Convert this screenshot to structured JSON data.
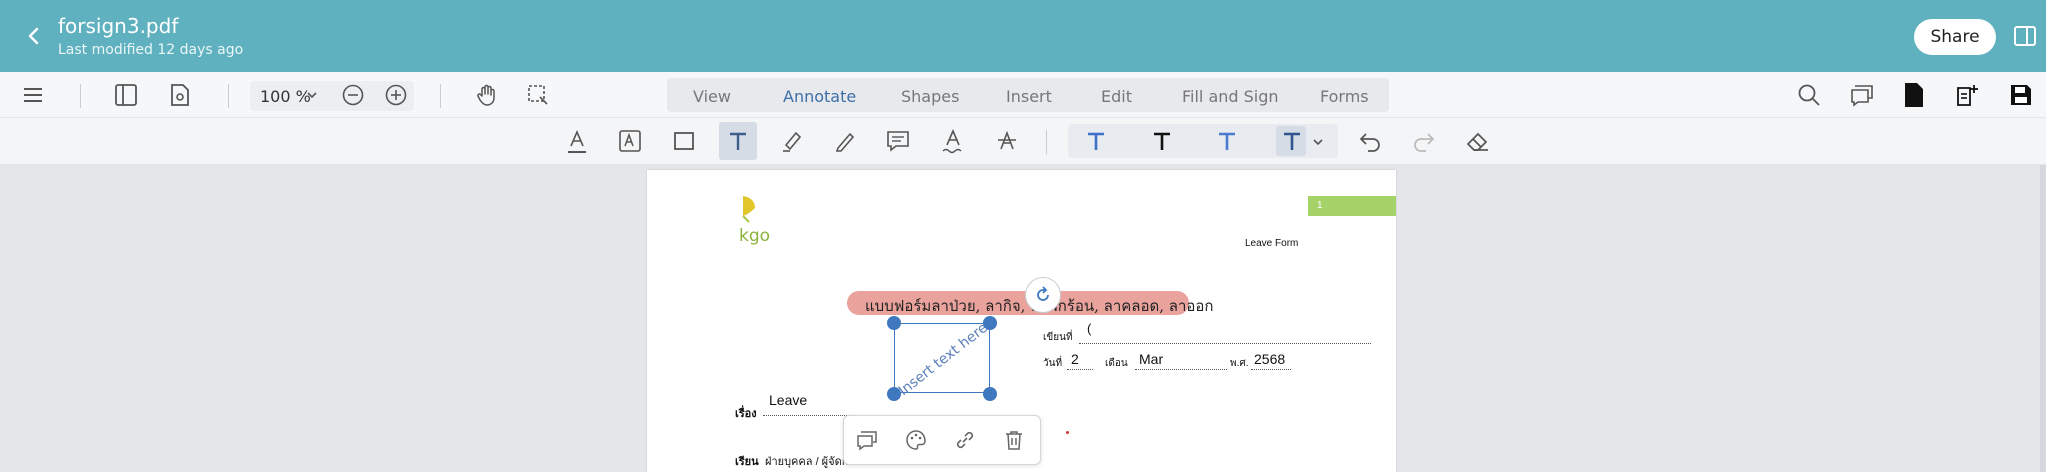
{
  "header": {
    "title": "forsign3.pdf",
    "subtitle": "Last modified 12 days ago",
    "share_label": "Share"
  },
  "toolbar": {
    "zoom": "100 %",
    "tabs": [
      {
        "label": "View"
      },
      {
        "label": "Annotate"
      },
      {
        "label": "Shapes"
      },
      {
        "label": "Insert"
      },
      {
        "label": "Edit"
      },
      {
        "label": "Fill and Sign"
      },
      {
        "label": "Forms"
      }
    ],
    "active_tab": "Annotate"
  },
  "colors": {
    "header_bg": "#5fb1bf",
    "accent": "#3e6fa8",
    "selection": "#3f78bf",
    "banner": "#e9a29c",
    "page_marker": "#a5d36a"
  },
  "page": {
    "page_number": "1",
    "doc_type": "Leave Form",
    "thai_title": "แบบฟอร์มลาป่วย, ลากิจ, ลาพักร้อน, ลาคลอด, ลาออก",
    "written_at_label": "เขียนที่",
    "written_at_value": "(",
    "date_label": "วันที่",
    "date_value": "2",
    "month_label": "เดือน",
    "month_value": "Mar",
    "year_label": "พ.ศ.",
    "year_value": "2568",
    "subject_label": "เรื่อง",
    "subject_value": "Leave",
    "to_label": "เรียน",
    "to_value": "ฝ่ายบุคคล / ผู้จัดก",
    "logo_text": "kgo"
  },
  "annotation": {
    "placeholder": "Insert text here"
  }
}
